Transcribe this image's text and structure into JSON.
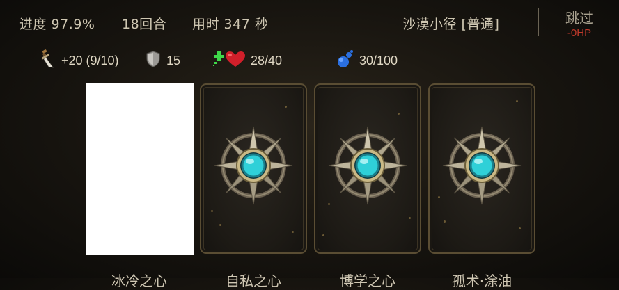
{
  "status": {
    "progress": "进度 97.9%",
    "rounds": "18回合",
    "time": "用时 347 秒",
    "stage": "沙漠小径 [普通]"
  },
  "skip": {
    "label": "跳过",
    "cost": "-0HP"
  },
  "stats": {
    "attack": "+20 (9/10)",
    "armor": "15",
    "health": "28/40",
    "mana": "30/100"
  },
  "icons": {
    "attack": "dagger-icon",
    "armor": "shield-icon",
    "health": "heal-heart-icon",
    "mana": "mana-potion-icon",
    "card_back": "compass-star-gem-icon"
  },
  "cards": [
    {
      "label": "冰冷之心"
    },
    {
      "label": "自私之心"
    },
    {
      "label": "博学之心"
    },
    {
      "label": "孤术·涂油"
    }
  ],
  "colors": {
    "gem": "#2fd0d8",
    "cost_red": "#c0392b",
    "card_border": "#5a4d33"
  }
}
